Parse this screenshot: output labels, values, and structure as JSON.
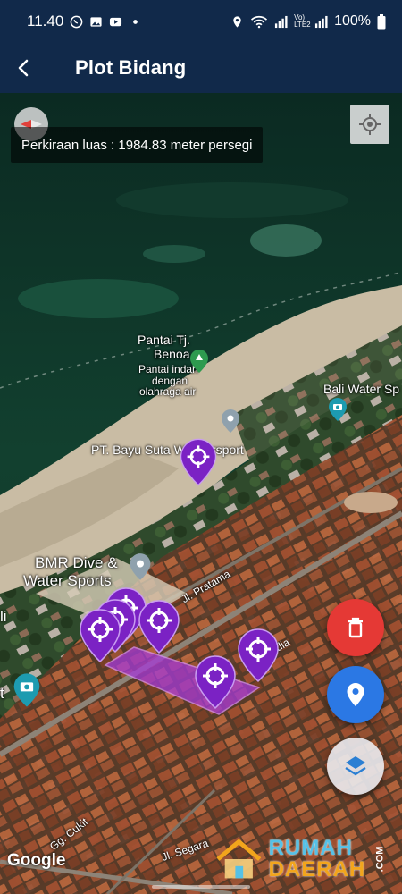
{
  "status_bar": {
    "time": "11.40",
    "battery": "100%",
    "network_label": "Vo) LTE2"
  },
  "app_bar": {
    "title": "Plot Bidang",
    "back_icon": "back-arrow-icon"
  },
  "map": {
    "area_info": "Perkiraan luas : 1984.83 meter persegi",
    "labels": {
      "pantai_title": "Pantai Tj.",
      "pantai_title2": "Benoa",
      "pantai_desc1": "Pantai indah",
      "pantai_desc2": "dengan",
      "pantai_desc3": "olahraga air",
      "bali_water": "Bali Water Sp",
      "bayu_suta": "PT. Bayu Suta Wa",
      "bayu_suta_end": "rsport",
      "bmr1": "BMR Dive &",
      "bmr2": "Water Sports",
      "left_li": "li",
      "left_t": "t",
      "pratama": "Jl. Pratama",
      "segara": "Jl. Segara",
      "cukit": "Gg. Cukit",
      "udia": "udia"
    },
    "attribution": "Google"
  },
  "fabs": {
    "delete_icon": "trash-icon",
    "location_icon": "location-pin-icon",
    "layers_icon": "layers-icon"
  },
  "watermark": {
    "line1": "RUMAH",
    "line2": "DAERAH",
    "suffix": ".COM"
  },
  "colors": {
    "app_bar": "#11294a",
    "marker": "#7b22c4",
    "polygon": "#a53ad8",
    "delete": "#e53935",
    "location": "#2b78e4"
  }
}
